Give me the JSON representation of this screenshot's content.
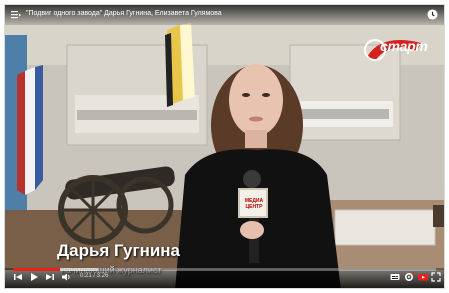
{
  "video": {
    "title": "\"Подвиг одного завода\" Дарья Гугнина, Елизавета Гулямова",
    "logo_text": "старт",
    "speaker_name": "Дарья Гугнина",
    "speaker_role": "начинающий журналист",
    "mic_label": "МЕДИА ЦЕНТР"
  },
  "controls": {
    "time": "0:21 / 3:26",
    "progress_fraction": 0.11,
    "buffer_fraction": 0.2
  },
  "colors": {
    "progress": "#e62117",
    "logo_red": "#d4231f"
  }
}
